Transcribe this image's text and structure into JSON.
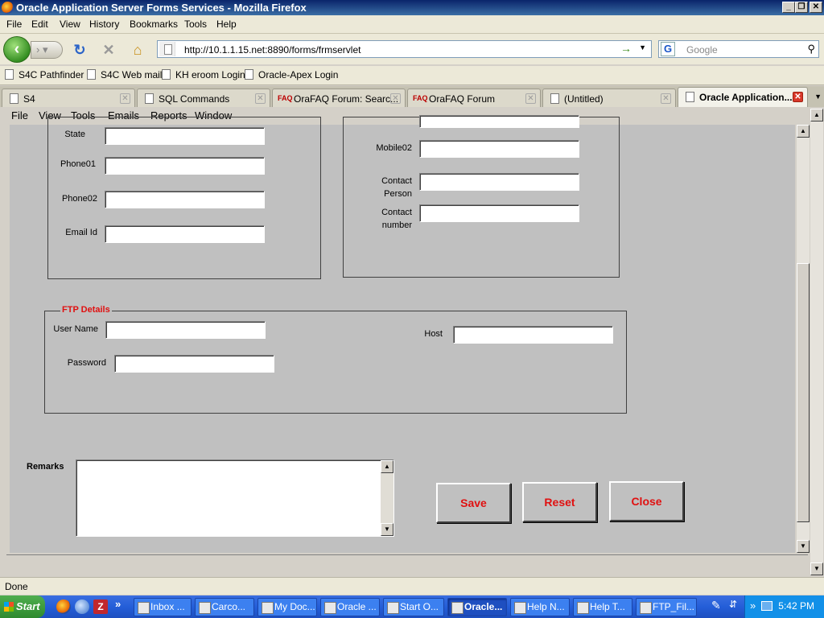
{
  "window": {
    "title": "Oracle Application Server Forms Services - Mozilla Firefox",
    "buttons": [
      "_",
      "❐",
      "✕"
    ]
  },
  "browser_menu": [
    "File",
    "Edit",
    "View",
    "History",
    "Bookmarks",
    "Tools",
    "Help"
  ],
  "nav": {
    "url": "http://10.1.1.15.net:8890/forms/frmservlet",
    "search_placeholder": "Google"
  },
  "bookmarks": [
    "S4C Pathfinder",
    "S4C Web mail",
    "KH eroom Login",
    "Oracle-Apex Login"
  ],
  "tabs": [
    {
      "label": "S4",
      "icon": "page-icon"
    },
    {
      "label": "SQL Commands",
      "icon": "page-icon"
    },
    {
      "label": "OraFAQ Forum: Searc...",
      "icon": "faq-icon"
    },
    {
      "label": "OraFAQ Forum",
      "icon": "faq-icon"
    },
    {
      "label": "(Untitled)",
      "icon": "page-icon"
    },
    {
      "label": "Oracle Application...",
      "icon": "page-icon",
      "active": true
    }
  ],
  "forms_menu": [
    "File",
    "View",
    "Tools",
    "Emails",
    "Reports",
    "Window"
  ],
  "form": {
    "left_labels": {
      "state": "State",
      "phone01": "Phone01",
      "phone02": "Phone02",
      "email": "Email Id"
    },
    "right_labels": {
      "mobile02": "Mobile02",
      "contact_person": "Contact Person",
      "contact_number": "Contact number"
    },
    "ftp": {
      "title": "FTP Details",
      "user_name": "User Name",
      "host": "Host",
      "password": "Password"
    },
    "remarks_label": "Remarks",
    "buttons": {
      "save": "Save",
      "reset": "Reset",
      "close": "Close"
    },
    "accent_color": "#e01010"
  },
  "status": "Done",
  "taskbar": {
    "start": "Start",
    "items": [
      "Inbox ...",
      "Carco...",
      "My Doc...",
      "Oracle ...",
      "Start O...",
      "Oracle...",
      "Help N...",
      "Help T...",
      "FTP_Fil..."
    ],
    "chevron": "»",
    "clock": "5:42 PM"
  }
}
